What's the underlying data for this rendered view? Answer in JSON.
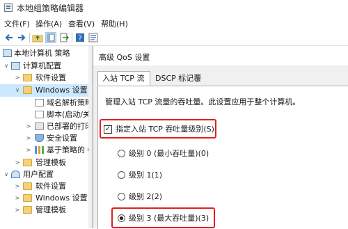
{
  "window": {
    "title": "本地组策略编辑器"
  },
  "menu": [
    "文件(F)",
    "操作(A)",
    "查看(V)",
    "帮助(H)"
  ],
  "toolbar": {
    "buttons": [
      "back-arrow-icon",
      "forward-arrow-icon",
      "folder-up-icon",
      "show-tree-icon",
      "export-list-icon",
      "help-icon",
      "properties-icon"
    ]
  },
  "tree": {
    "root": "本地计算机 策略",
    "computer_config": "计算机配置",
    "software_settings": "软件设置",
    "windows_settings": "Windows 设置",
    "name_resolution": "域名解析策略",
    "scripts": "脚本(启动/关",
    "printers": "已部署的打印",
    "security_settings": "安全设置",
    "policy_qos": "基于策略的 C",
    "admin_templates": "管理模板",
    "user_config": "用户配置",
    "user_software": "软件设置",
    "user_windows": "Windows 设置",
    "user_admin": "管理模板"
  },
  "dialog": {
    "title": "高级 QoS 设置",
    "tabs": [
      "入站 TCP 流量",
      "DSCP 标记覆盖"
    ],
    "description": "管理入站 TCP 流量的吞吐量。此设置应用于整个计算机。",
    "checkbox_label": "指定入站 TCP 吞吐量级别(S):",
    "checkbox_checked": true,
    "options": [
      "级别 0 (最小吞吐量)(0)",
      "级别 1(1)",
      "级别 2(2)",
      "级别 3 (最大吞吐量)(3)"
    ],
    "selected_option": 3
  },
  "colors": {
    "highlight": "#e02020",
    "selection": "#cce8ff"
  }
}
